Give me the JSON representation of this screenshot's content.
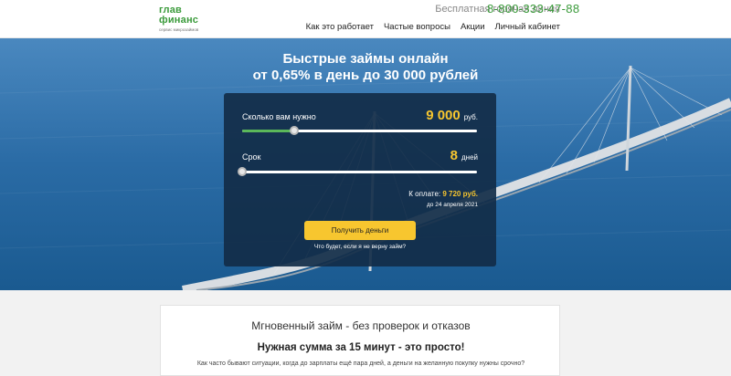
{
  "header": {
    "logo_line1": "глав",
    "logo_line2": "финанс",
    "logo_sub": "сервис микрозаймов",
    "hotline_label": "Бесплатная горячая линия",
    "phone": "8-800-333-47-88",
    "nav": [
      {
        "label": "Как это работает"
      },
      {
        "label": "Частые вопросы"
      },
      {
        "label": "Акции"
      },
      {
        "label": "Личный кабинет"
      }
    ]
  },
  "hero": {
    "title_line1": "Быстрые займы онлайн",
    "title_line2": "от 0,65% в день до 30 000 рублей"
  },
  "calculator": {
    "amount_label": "Сколько вам нужно",
    "amount_value": "9 000",
    "amount_unit": "руб.",
    "amount_fraction": 0.22,
    "term_label": "Срок",
    "term_value": "8",
    "term_unit": "дней",
    "term_fraction": 0.0,
    "pay_label": "К оплате:",
    "pay_amount": "9 720 руб.",
    "due_date": "до 24 апреля 2021",
    "cta_label": "Получить деньги",
    "faq_link": "Что будет, если я не верну займ?"
  },
  "content": {
    "title": "Мгновенный займ - без проверок и отказов",
    "subtitle": "Нужная сумма за 15 минут - это просто!",
    "text": "Как часто бывают ситуации, когда до зарплаты ещё пара дней, а деньги на желанную покупку нужны срочно?"
  },
  "colors": {
    "brand_green": "#3a9a3a",
    "accent_yellow": "#f7c62f",
    "panel_bg": "#122d48"
  }
}
